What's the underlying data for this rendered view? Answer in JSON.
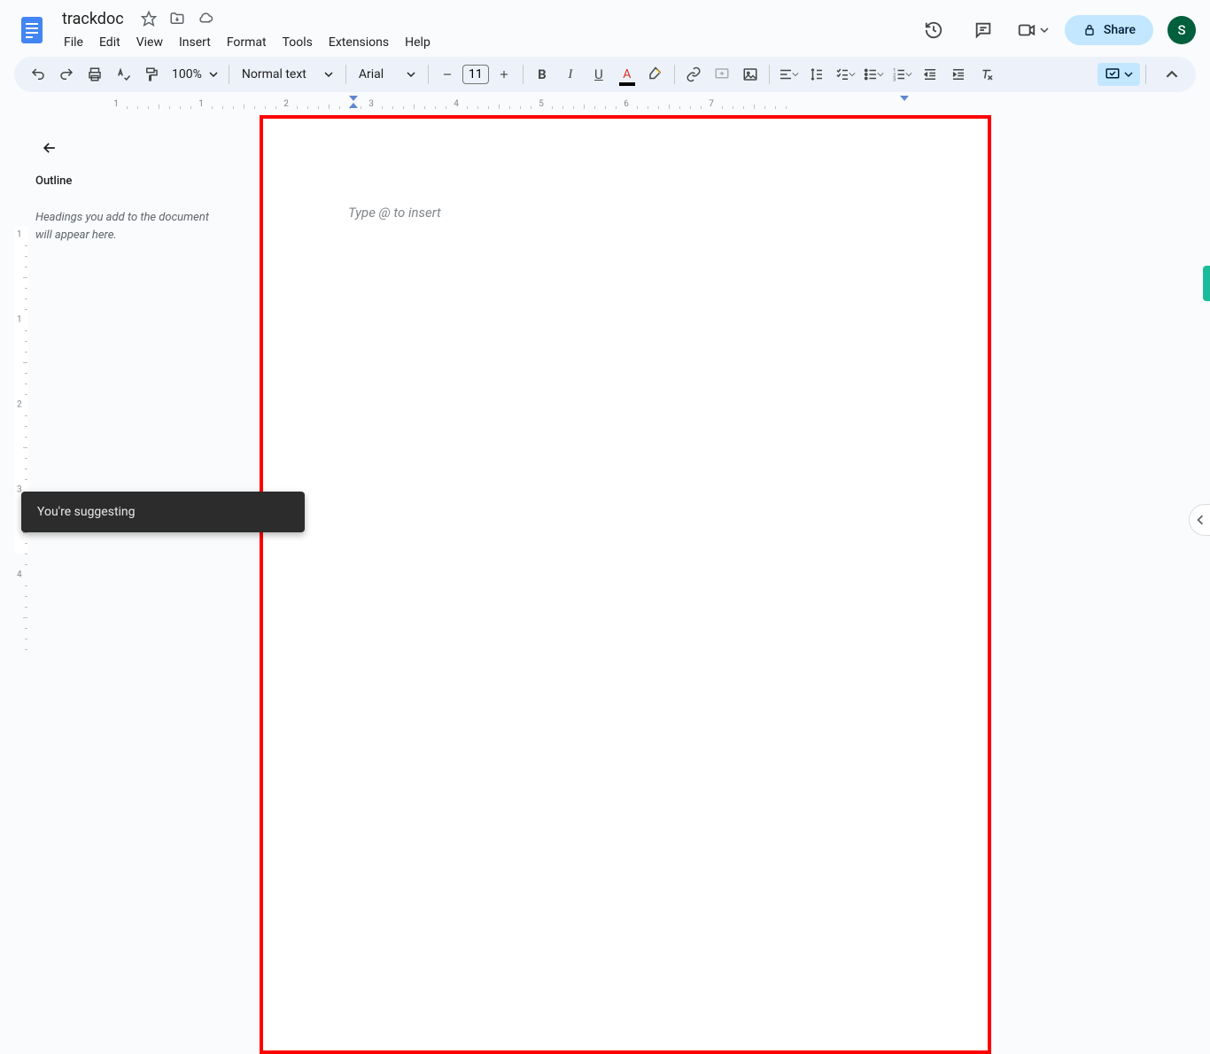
{
  "doc": {
    "title": "trackdoc"
  },
  "menus": {
    "file": "File",
    "edit": "Edit",
    "view": "View",
    "insert": "Insert",
    "format": "Format",
    "tools": "Tools",
    "extensions": "Extensions",
    "help": "Help"
  },
  "share": {
    "label": "Share"
  },
  "avatar": {
    "initial": "S"
  },
  "toolbar": {
    "zoom": "100%",
    "style": "Normal text",
    "font": "Arial",
    "fontsize": "11"
  },
  "outline": {
    "title": "Outline",
    "hint": "Headings you add to the document will appear here."
  },
  "page": {
    "placeholder": "Type @ to insert"
  },
  "toast": {
    "message": "You're suggesting"
  },
  "ruler": {
    "h": [
      "1",
      "1",
      "2",
      "3",
      "4",
      "5",
      "6",
      "7"
    ],
    "v": [
      "1",
      "1",
      "2",
      "3",
      "4"
    ]
  }
}
